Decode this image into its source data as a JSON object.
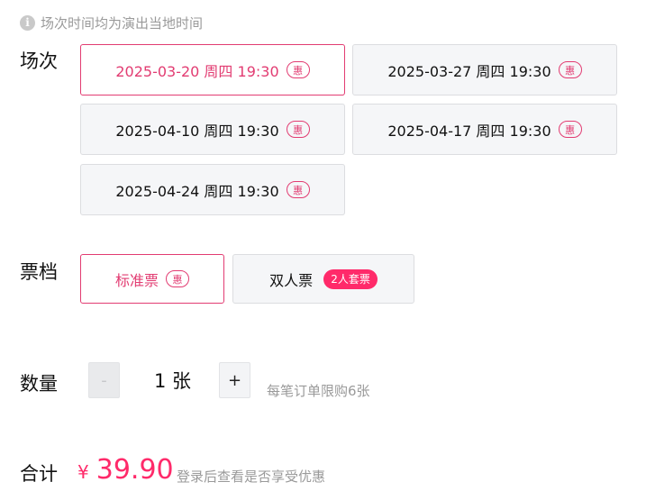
{
  "notice": {
    "icon": "info-icon",
    "text": "场次时间均为演出当地时间"
  },
  "sessions": {
    "label": "场次",
    "items": [
      {
        "text": "2025-03-20 周四 19:30",
        "badge": "惠",
        "selected": true
      },
      {
        "text": "2025-03-27 周四 19:30",
        "badge": "惠",
        "selected": false
      },
      {
        "text": "2025-04-10 周四 19:30",
        "badge": "惠",
        "selected": false
      },
      {
        "text": "2025-04-17 周四 19:30",
        "badge": "惠",
        "selected": false
      },
      {
        "text": "2025-04-24 周四 19:30",
        "badge": "惠",
        "selected": false
      }
    ]
  },
  "tiers": {
    "label": "票档",
    "items": [
      {
        "text": "标准票",
        "badge": "惠",
        "selected": true
      },
      {
        "text": "双人票",
        "badge": "2人套票",
        "selected": false
      }
    ]
  },
  "quantity": {
    "label": "数量",
    "minus": "-",
    "plus": "+",
    "value": "1 张",
    "limit_note": "每笔订单限购6张"
  },
  "total": {
    "label": "合计",
    "currency": "¥",
    "amount": "39.90",
    "note": "登录后查看是否享受优惠"
  },
  "colors": {
    "accent": "#e23c72",
    "badge_fill": "#ff2a6a",
    "muted": "#9a9a9a"
  }
}
